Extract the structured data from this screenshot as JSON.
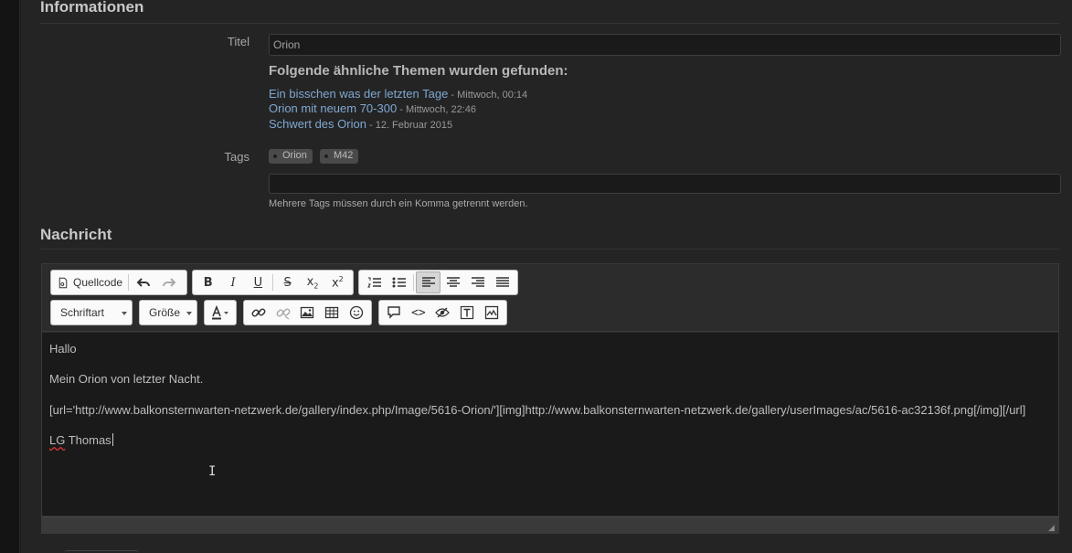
{
  "sections": {
    "info_title": "Informationen",
    "message_title": "Nachricht"
  },
  "form": {
    "title_label": "Titel",
    "title_value": "Orion",
    "tags_label": "Tags",
    "tags": [
      "Orion",
      "M42"
    ],
    "tags_input_value": "",
    "tags_help": "Mehrere Tags müssen durch ein Komma getrennt werden."
  },
  "similar": {
    "heading": "Folgende ähnliche Themen wurden gefunden:",
    "items": [
      {
        "title": "Ein bisschen was der letzten Tage",
        "date": " - Mittwoch, 00:14"
      },
      {
        "title": "Orion mit neuem 70-300",
        "date": " - Mittwoch, 22:46"
      },
      {
        "title": "Schwert des Orion",
        "date": " - 12. Februar 2015"
      }
    ]
  },
  "toolbar": {
    "source_label": "Quellcode",
    "font_label": "Schriftart",
    "size_label": "Größe"
  },
  "editor": {
    "lines": [
      "Hallo",
      "Mein Orion von letzter Nacht.",
      "[url='http://www.balkonsternwarten-netzwerk.de/gallery/index.php/Image/5616-Orion/'][img]http://www.balkonsternwarten-netzwerk.de/gallery/userImages/ac/5616-ac32136f.png[/img][/url]"
    ],
    "signature_initials": "LG",
    "signature_name": " Thomas"
  }
}
